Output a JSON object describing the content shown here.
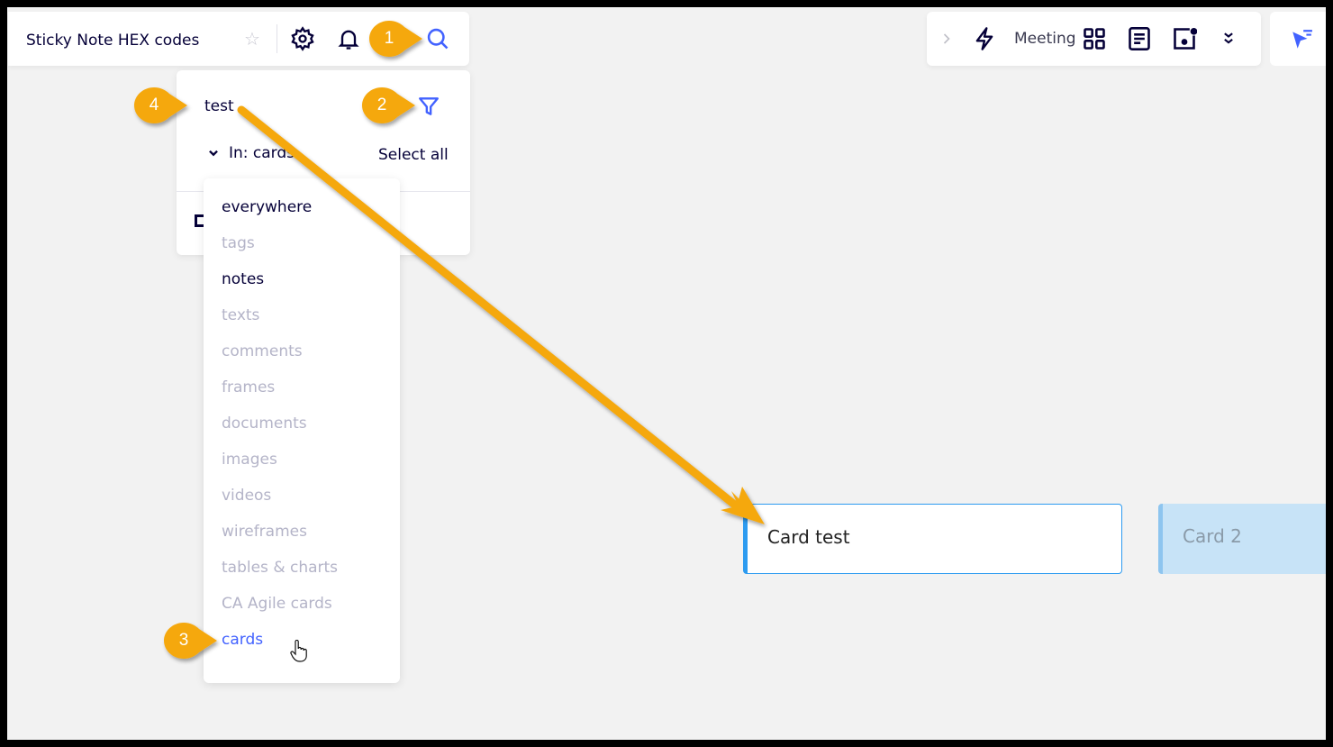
{
  "board": {
    "title": "Sticky Note HEX codes"
  },
  "toolbar_left": {
    "icons": [
      "star-icon",
      "gear-icon",
      "bell-icon",
      "search-icon"
    ]
  },
  "toolbar_right": {
    "meeting_label": "Meeting",
    "icons": [
      "chevron-right-icon",
      "lightning-icon",
      "grid-icon",
      "document-icon",
      "frame-icon",
      "double-chevron-down-icon"
    ]
  },
  "toolbar_far": {
    "icons": [
      "cursor-filter-icon"
    ]
  },
  "search": {
    "value": "test",
    "scope_label": "In: cards",
    "select_all_label": "Select all"
  },
  "scope_options": [
    {
      "label": "everywhere",
      "state": "enabled"
    },
    {
      "label": "tags",
      "state": "disabled"
    },
    {
      "label": "notes",
      "state": "enabled"
    },
    {
      "label": "texts",
      "state": "disabled"
    },
    {
      "label": "comments",
      "state": "disabled"
    },
    {
      "label": "frames",
      "state": "disabled"
    },
    {
      "label": "documents",
      "state": "disabled"
    },
    {
      "label": "images",
      "state": "disabled"
    },
    {
      "label": "videos",
      "state": "disabled"
    },
    {
      "label": "wireframes",
      "state": "disabled"
    },
    {
      "label": "tables & charts",
      "state": "disabled"
    },
    {
      "label": "CA Agile cards",
      "state": "disabled"
    },
    {
      "label": "cards",
      "state": "active"
    }
  ],
  "cards": [
    {
      "title": "Card  test"
    },
    {
      "title": "Card 2"
    }
  ],
  "callouts": [
    "1",
    "2",
    "3",
    "4"
  ],
  "colors": {
    "accent": "#4262ff",
    "callout": "#f5a80f",
    "card_border": "#2d9bf0",
    "card2_bg": "#c7e3f7"
  }
}
